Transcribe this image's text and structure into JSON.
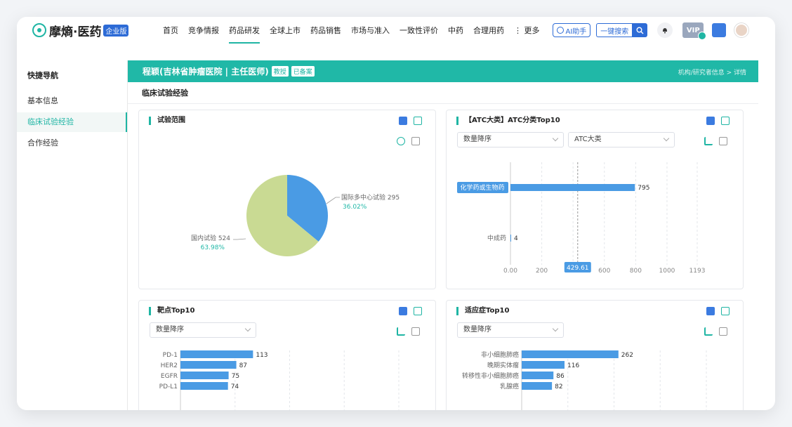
{
  "brand": {
    "name": "摩熵·医药",
    "edition": "企业版"
  },
  "nav": [
    "首页",
    "竞争情报",
    "药品研发",
    "全球上市",
    "药品销售",
    "市场与准入",
    "一致性评价",
    "中药",
    "合理用药",
    "更多"
  ],
  "nav_active": "药品研发",
  "ai_button": "AI助手",
  "search_label": "一键搜索",
  "vip": "VIP",
  "sidebar": {
    "title": "快捷导航",
    "items": [
      "基本信息",
      "临床试验经验",
      "合作经验"
    ],
    "active": "临床试验经验"
  },
  "header": {
    "doctor": "程颖(吉林省肿瘤医院 | 主任医师)",
    "tags": [
      "教授",
      "已备案"
    ],
    "breadcrumb": "机构/研究者信息 > 详情"
  },
  "section_title": "临床试验经验",
  "cards": {
    "scope": {
      "title": "试验范围"
    },
    "atc": {
      "title": "【ATC大类】ATC分类Top10",
      "sort": "数量降序",
      "filter": "ATC大类"
    },
    "target": {
      "title": "靶点Top10",
      "sort": "数量降序"
    },
    "indication": {
      "title": "适应症Top10",
      "sort": "数量降序"
    }
  },
  "chart_data": [
    {
      "type": "pie",
      "title": "试验范围",
      "slices": [
        {
          "label": "国际多中心试验",
          "value": 295,
          "percent": "36.02%"
        },
        {
          "label": "国内试验",
          "value": 524,
          "percent": "63.98%"
        }
      ],
      "colors": [
        "#4a9be4",
        "#c9da93"
      ]
    },
    {
      "type": "bar",
      "title": "【ATC大类】ATC分类Top10",
      "categories": [
        "化学药或生物药",
        "中成药"
      ],
      "values": [
        795,
        4
      ],
      "xticks": [
        "0.00",
        "200",
        "400",
        "600",
        "800",
        "1000",
        "1193"
      ],
      "xlim": [
        0,
        1193
      ],
      "marker": {
        "value": 429.61,
        "label": "429.61"
      }
    },
    {
      "type": "bar",
      "title": "靶点Top10",
      "categories": [
        "PD-1",
        "HER2",
        "EGFR",
        "PD-L1"
      ],
      "values": [
        113,
        87,
        75,
        74
      ],
      "xlim": [
        0,
        340
      ]
    },
    {
      "type": "bar",
      "title": "适应症Top10",
      "categories": [
        "非小细胞肺癌",
        "晚期实体瘤",
        "转移性非小细胞肺癌",
        "乳腺癌"
      ],
      "values": [
        262,
        116,
        86,
        82
      ],
      "xlim": [
        0,
        500
      ]
    }
  ],
  "colors": {
    "accent": "#20b8a7",
    "bar": "#4a9be4",
    "brand_blue": "#2d6bd6"
  }
}
